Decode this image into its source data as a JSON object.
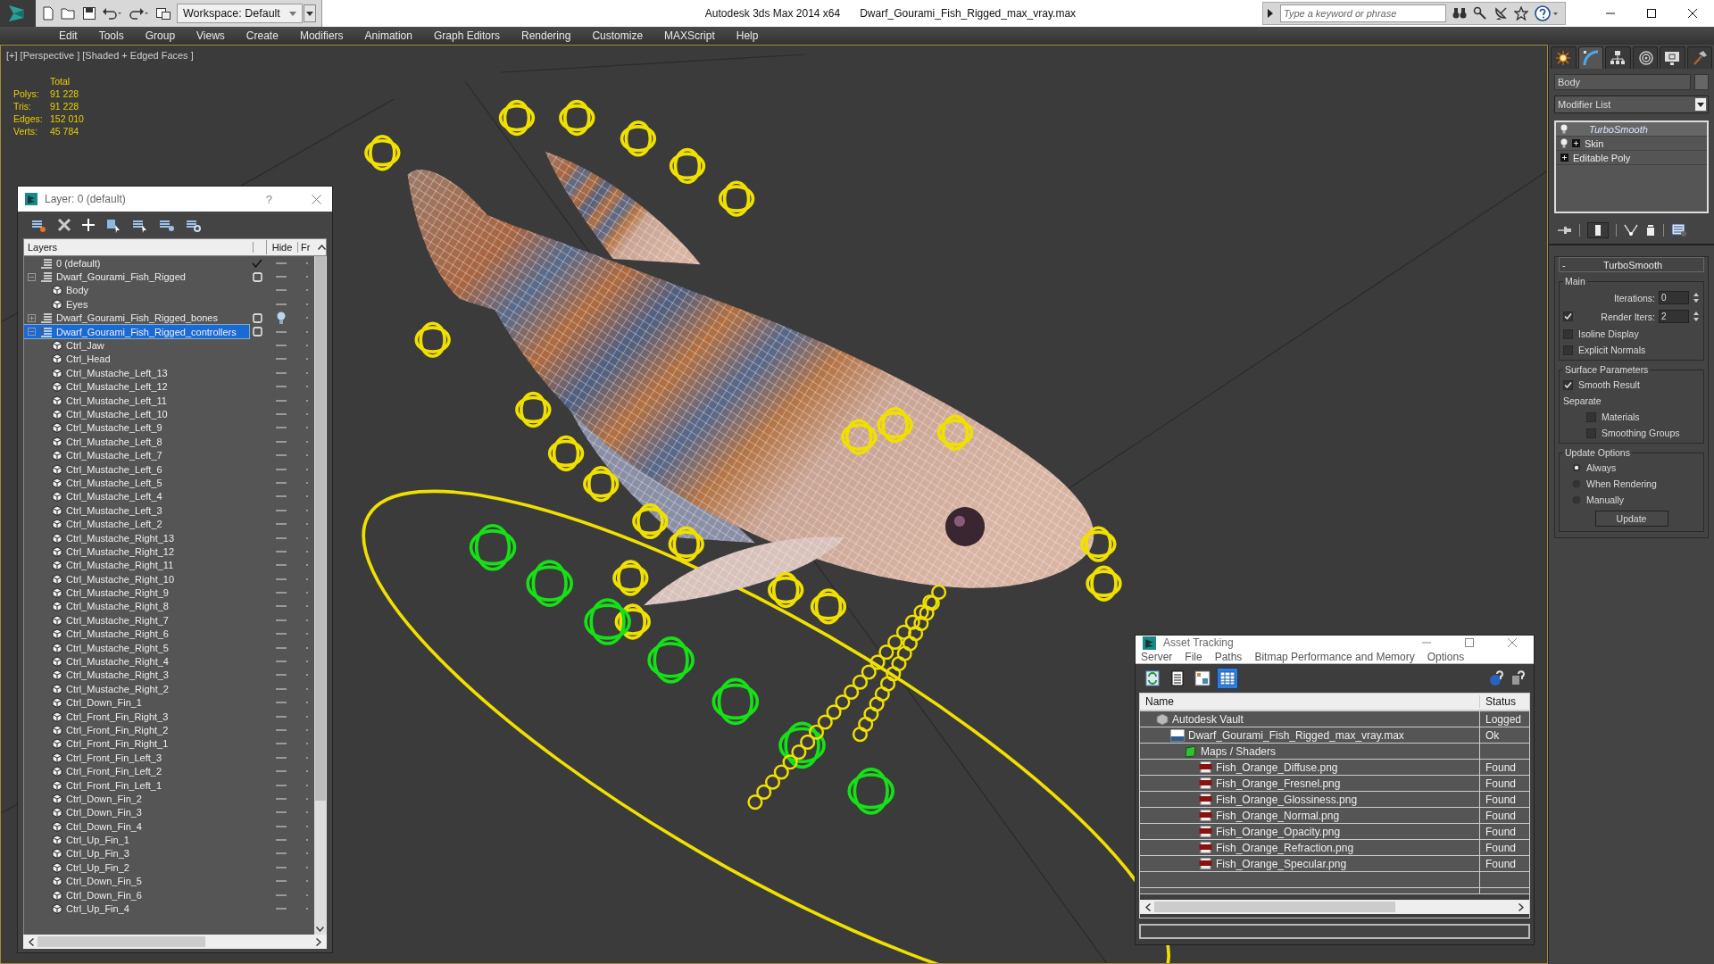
{
  "title_bar": {
    "workspace": "Workspace: Default",
    "app_title": "Autodesk 3ds Max  2014 x64",
    "file_name": "Dwarf_Gourami_Fish_Rigged_max_vray.max",
    "search": {
      "placeholder": "Type a keyword or phrase"
    }
  },
  "menu": [
    "Edit",
    "Tools",
    "Group",
    "Views",
    "Create",
    "Modifiers",
    "Animation",
    "Graph Editors",
    "Rendering",
    "Customize",
    "MAXScript",
    "Help"
  ],
  "viewport": {
    "label": "[+] [Perspective ] [Shaded + Edged Faces ]",
    "stats": {
      "header": "Total",
      "rows": [
        {
          "label": "Polys:",
          "value": "91 228"
        },
        {
          "label": "Tris:",
          "value": "91 228"
        },
        {
          "label": "Edges:",
          "value": "152 010"
        },
        {
          "label": "Verts:",
          "value": "45 784"
        }
      ]
    }
  },
  "layer_window": {
    "title": "Layer: 0 (default)",
    "help": "?",
    "columns": [
      "Layers",
      "Hide",
      "Fr"
    ],
    "layers": [
      {
        "name": "0 (default)",
        "current": true,
        "selected": false,
        "hidden": false
      },
      {
        "name": "Dwarf_Gourami_Fish_Rigged",
        "current": false,
        "selected": false,
        "hidden": false,
        "expanded": true,
        "children": [
          {
            "name": "Body"
          },
          {
            "name": "Eyes"
          }
        ]
      },
      {
        "name": "Dwarf_Gourami_Fish_Rigged_bones",
        "current": false,
        "selected": false,
        "hidden": true,
        "expanded": false
      },
      {
        "name": "Dwarf_Gourami_Fish_Rigged_controllers",
        "current": false,
        "selected": true,
        "hidden": false,
        "expanded": true,
        "children": [
          {
            "name": "Ctrl_Jaw"
          },
          {
            "name": "Ctrl_Head"
          },
          {
            "name": "Ctrl_Mustache_Left_13"
          },
          {
            "name": "Ctrl_Mustache_Left_12"
          },
          {
            "name": "Ctrl_Mustache_Left_11"
          },
          {
            "name": "Ctrl_Mustache_Left_10"
          },
          {
            "name": "Ctrl_Mustache_Left_9"
          },
          {
            "name": "Ctrl_Mustache_Left_8"
          },
          {
            "name": "Ctrl_Mustache_Left_7"
          },
          {
            "name": "Ctrl_Mustache_Left_6"
          },
          {
            "name": "Ctrl_Mustache_Left_5"
          },
          {
            "name": "Ctrl_Mustache_Left_4"
          },
          {
            "name": "Ctrl_Mustache_Left_3"
          },
          {
            "name": "Ctrl_Mustache_Left_2"
          },
          {
            "name": "Ctrl_Mustache_Right_13"
          },
          {
            "name": "Ctrl_Mustache_Right_12"
          },
          {
            "name": "Ctrl_Mustache_Right_11"
          },
          {
            "name": "Ctrl_Mustache_Right_10"
          },
          {
            "name": "Ctrl_Mustache_Right_9"
          },
          {
            "name": "Ctrl_Mustache_Right_8"
          },
          {
            "name": "Ctrl_Mustache_Right_7"
          },
          {
            "name": "Ctrl_Mustache_Right_6"
          },
          {
            "name": "Ctrl_Mustache_Right_5"
          },
          {
            "name": "Ctrl_Mustache_Right_4"
          },
          {
            "name": "Ctrl_Mustache_Right_3"
          },
          {
            "name": "Ctrl_Mustache_Right_2"
          },
          {
            "name": "Ctrl_Down_Fin_1"
          },
          {
            "name": "Ctrl_Front_Fin_Right_3"
          },
          {
            "name": "Ctrl_Front_Fin_Right_2"
          },
          {
            "name": "Ctrl_Front_Fin_Right_1"
          },
          {
            "name": "Ctrl_Front_Fin_Left_3"
          },
          {
            "name": "Ctrl_Front_Fin_Left_2"
          },
          {
            "name": "Ctrl_Front_Fin_Left_1"
          },
          {
            "name": "Ctrl_Down_Fin_2"
          },
          {
            "name": "Ctrl_Down_Fin_3"
          },
          {
            "name": "Ctrl_Down_Fin_4"
          },
          {
            "name": "Ctrl_Up_Fin_1"
          },
          {
            "name": "Ctrl_Up_Fin_3"
          },
          {
            "name": "Ctrl_Up_Fin_2"
          },
          {
            "name": "Ctrl_Down_Fin_5"
          },
          {
            "name": "Ctrl_Down_Fin_6"
          },
          {
            "name": "Ctrl_Up_Fin_4"
          }
        ]
      }
    ]
  },
  "command_panel": {
    "tabs": [
      {
        "kind": "create",
        "selected": false
      },
      {
        "kind": "modify",
        "selected": true
      },
      {
        "kind": "hierarchy",
        "selected": false
      },
      {
        "kind": "motion",
        "selected": false
      },
      {
        "kind": "display",
        "selected": false
      },
      {
        "kind": "utilities",
        "selected": false
      }
    ],
    "object_name": "Body",
    "modifier_list": "Modifier List",
    "stack": [
      {
        "name": "TurboSmooth",
        "kind": "modifier",
        "selected": true,
        "expandable": false
      },
      {
        "name": "Skin",
        "kind": "modifier",
        "selected": false,
        "expandable": true
      },
      {
        "name": "Editable Poly",
        "kind": "base",
        "selected": false,
        "expandable": true
      }
    ],
    "rollout": {
      "toggle": "-",
      "title": "TurboSmooth",
      "sections": [
        {
          "title": "Main",
          "controls": [
            {
              "kind": "spinner",
              "label": "Iterations:",
              "value": "0"
            },
            {
              "kind": "check_spinner",
              "label": "Render Iters:",
              "checked": true,
              "value": "2"
            },
            {
              "kind": "checkbox",
              "label": "Isoline Display",
              "checked": false,
              "indented": false
            },
            {
              "kind": "checkbox",
              "label": "Explicit Normals",
              "checked": false,
              "indented": false
            }
          ]
        },
        {
          "title": "Surface Parameters",
          "controls": [
            {
              "kind": "checkbox",
              "label": "Smooth Result",
              "checked": true,
              "indented": false
            },
            {
              "kind": "label",
              "label": "Separate"
            },
            {
              "kind": "checkbox",
              "label": "Materials",
              "checked": false,
              "indented": true
            },
            {
              "kind": "checkbox",
              "label": "Smoothing Groups",
              "checked": false,
              "indented": true
            }
          ]
        },
        {
          "title": "Update Options",
          "controls": [
            {
              "kind": "radio",
              "label": "Always",
              "selected": true
            },
            {
              "kind": "radio",
              "label": "When Rendering",
              "selected": false
            },
            {
              "kind": "radio",
              "label": "Manually",
              "selected": false
            },
            {
              "kind": "button",
              "label": "Update"
            }
          ]
        }
      ]
    }
  },
  "asset_tracking": {
    "title": "Asset Tracking",
    "menu": [
      "Server",
      "File",
      "Paths",
      "Bitmap Performance and Memory",
      "Options"
    ],
    "toolbar": [
      {
        "kind": "refresh",
        "selected": false
      },
      {
        "kind": "list",
        "selected": false
      },
      {
        "kind": "thumbnails",
        "selected": false
      },
      {
        "kind": "table",
        "selected": true
      }
    ],
    "columns": [
      "Name",
      "Status"
    ],
    "rows": [
      {
        "kind": "vault",
        "name": "Autodesk Vault",
        "status": "Logged",
        "children": [
          {
            "kind": "max",
            "name": "Dwarf_Gourami_Fish_Rigged_max_vray.max",
            "status": "Ok",
            "children": [
              {
                "kind": "folder",
                "name": "Maps / Shaders",
                "children": [
                  {
                    "kind": "png",
                    "name": "Fish_Orange_Diffuse.png",
                    "status": "Found"
                  },
                  {
                    "kind": "png",
                    "name": "Fish_Orange_Fresnel.png",
                    "status": "Found"
                  },
                  {
                    "kind": "png",
                    "name": "Fish_Orange_Glossiness.png",
                    "status": "Found"
                  },
                  {
                    "kind": "png",
                    "name": "Fish_Orange_Normal.png",
                    "status": "Found"
                  },
                  {
                    "kind": "png",
                    "name": "Fish_Orange_Opacity.png",
                    "status": "Found"
                  },
                  {
                    "kind": "png",
                    "name": "Fish_Orange_Refraction.png",
                    "status": "Found"
                  },
                  {
                    "kind": "png",
                    "name": "Fish_Orange_Specular.png",
                    "status": "Found"
                  }
                ]
              }
            ]
          }
        ]
      }
    ]
  }
}
